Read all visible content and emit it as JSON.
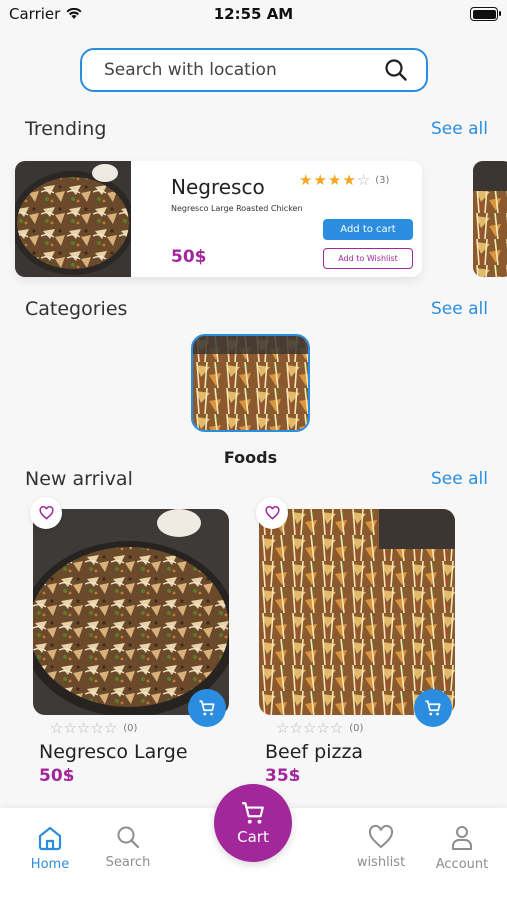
{
  "status_bar": {
    "carrier": "Carrier",
    "time": "12:55 AM"
  },
  "search": {
    "placeholder": "Search with location"
  },
  "trending": {
    "title": "Trending",
    "see_all": "See all",
    "card": {
      "name": "Negresco",
      "description": "Negresco Large Roasted Chicken",
      "price": "50$",
      "rating": 4,
      "rating_count": "(3)",
      "add_to_cart": "Add to cart",
      "add_to_wishlist": "Add to Wishlist"
    }
  },
  "categories": {
    "title": "Categories",
    "see_all": "See all",
    "items": [
      {
        "label": "Foods"
      }
    ]
  },
  "new_arrival": {
    "title": "New arrival",
    "see_all": "See all",
    "products": [
      {
        "name": "Negresco Large",
        "price": "50$",
        "rating_count": "(0)",
        "rating": 0
      },
      {
        "name": "Beef pizza",
        "price": "35$",
        "rating_count": "(0)",
        "rating": 0
      }
    ]
  },
  "bottom_nav": {
    "items": [
      {
        "label": "Home",
        "icon": "home-icon",
        "active": true
      },
      {
        "label": "Search",
        "icon": "search-icon",
        "active": false
      },
      {
        "label": "wishlist",
        "icon": "heart-icon",
        "active": false
      },
      {
        "label": "Account",
        "icon": "user-icon",
        "active": false
      }
    ],
    "cart_label": "Cart"
  },
  "colors": {
    "accent_blue": "#2b8de0",
    "accent_purple": "#a1279a",
    "star": "#f5a623"
  }
}
